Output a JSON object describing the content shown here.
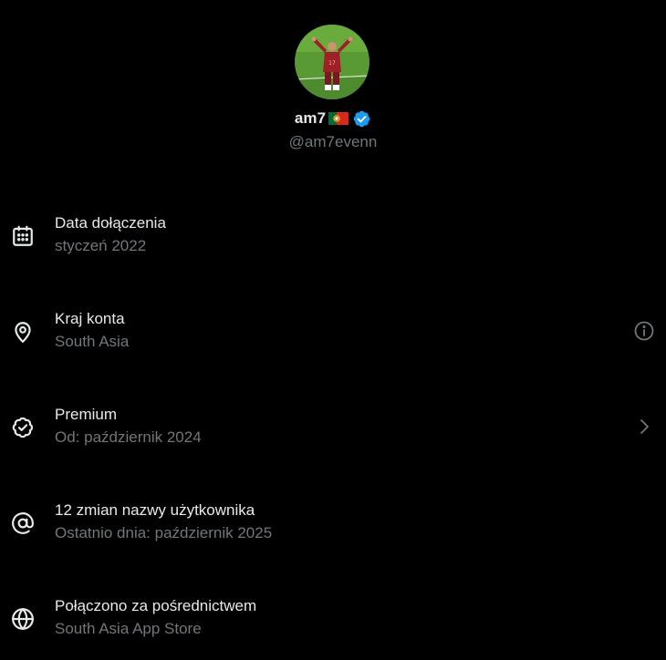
{
  "profile": {
    "display_name": "am7",
    "handle": "@am7evenn",
    "flag": "portugal-flag-icon",
    "verified": "verified-badge-icon"
  },
  "rows": [
    {
      "icon": "calendar-icon",
      "title": "Data dołączenia",
      "subtitle": "styczeń 2022"
    },
    {
      "icon": "location-pin-icon",
      "title": "Kraj konta",
      "subtitle": "South Asia",
      "action": "info-icon"
    },
    {
      "icon": "verified-check-icon",
      "title": "Premium",
      "subtitle": "Od: październik 2024",
      "action": "chevron-right-icon"
    },
    {
      "icon": "at-sign-icon",
      "title": "12 zmian nazwy użytkownika",
      "subtitle": "Ostatnio dnia: październik 2025"
    },
    {
      "icon": "globe-icon",
      "title": "Połączono za pośrednictwem",
      "subtitle": "South Asia App Store"
    }
  ],
  "colors": {
    "background": "#000000",
    "primary_text": "#e7e9ea",
    "secondary_text": "#71767b",
    "verified_blue": "#1d9bf0"
  }
}
